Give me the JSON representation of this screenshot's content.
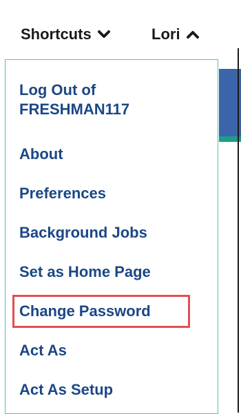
{
  "top_nav": {
    "shortcuts_label": "Shortcuts",
    "user_label": "Lori"
  },
  "dropdown": {
    "items": [
      {
        "label": "Log Out of FRESHMAN117"
      },
      {
        "label": "About"
      },
      {
        "label": "Preferences"
      },
      {
        "label": "Background Jobs"
      },
      {
        "label": "Set as Home Page"
      },
      {
        "label": "Change Password"
      },
      {
        "label": "Act As"
      },
      {
        "label": "Act As Setup"
      }
    ]
  },
  "colors": {
    "menu_text": "#1b4785",
    "dropdown_border": "#59c2b0",
    "highlight_border": "#e04f54",
    "background_blue": "#3b64ab",
    "background_teal": "#1aa089"
  },
  "icons": {
    "shortcuts_chevron": "chevron-down-icon",
    "user_chevron": "chevron-up-icon"
  }
}
